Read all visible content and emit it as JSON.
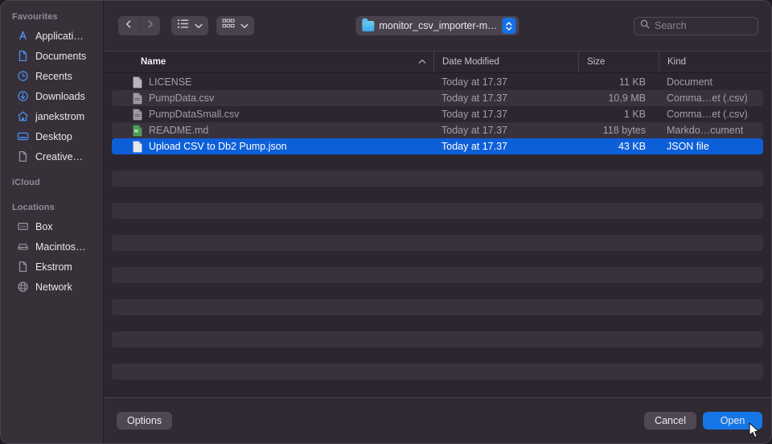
{
  "window": {
    "title": "Open File Dialog",
    "accent_color": "#1577e6",
    "selection_color": "#0d5fd8",
    "background": "#2f2a34",
    "sidebar_background": "#373039",
    "list_background": "#2b2630",
    "stripe_color": "#38323d"
  },
  "sidebar": {
    "sections": [
      {
        "header": "Favourites",
        "items": [
          {
            "label": "Applicati…",
            "icon": "applications-icon",
            "color": "#4a90f0"
          },
          {
            "label": "Documents",
            "icon": "documents-folder-icon",
            "color": "#4a90f0"
          },
          {
            "label": "Recents",
            "icon": "clock-icon",
            "color": "#4a90f0"
          },
          {
            "label": "Downloads",
            "icon": "download-circle-icon",
            "color": "#4a90f0"
          },
          {
            "label": "janekstrom",
            "icon": "home-icon",
            "color": "#4a90f0"
          },
          {
            "label": "Desktop",
            "icon": "desktop-icon",
            "color": "#4a90f0"
          },
          {
            "label": "Creative…",
            "icon": "document-icon",
            "color": "#9a939f"
          }
        ]
      },
      {
        "header": "iCloud",
        "items": []
      },
      {
        "header": "Locations",
        "items": [
          {
            "label": "Box",
            "icon": "box-drive-icon",
            "color": "#9a939f"
          },
          {
            "label": "Macintos…",
            "icon": "hard-drive-icon",
            "color": "#9a939f"
          },
          {
            "label": "Ekstrom",
            "icon": "document-icon",
            "color": "#9a939f"
          },
          {
            "label": "Network",
            "icon": "globe-icon",
            "color": "#9a939f"
          }
        ]
      }
    ]
  },
  "toolbar": {
    "back_icon": "chevron-left-icon",
    "forward_icon": "chevron-right-icon",
    "list_view_icon": "list-view-icon",
    "grid_view_icon": "grid-view-icon",
    "view_chevron_icon": "chevron-down-icon",
    "path": {
      "label": "monitor_csv_importer-m…",
      "folder_icon": "folder-icon",
      "stepper_icon": "up-down-stepper-icon"
    },
    "search": {
      "placeholder": "Search",
      "icon": "search-icon"
    }
  },
  "columns": {
    "name": "Name",
    "date_modified": "Date Modified",
    "size": "Size",
    "kind": "Kind",
    "sort_column": "Name",
    "sort_direction": "ascending",
    "sort_icon": "chevron-up-icon"
  },
  "files": [
    {
      "name": "LICENSE",
      "date_modified": "Today at 17.37",
      "size": "11 KB",
      "kind": "Document",
      "icon": "document-file-icon",
      "icon_tint": "#b9b4bd",
      "selected": false
    },
    {
      "name": "PumpData.csv",
      "date_modified": "Today at 17.37",
      "size": "10,9 MB",
      "kind": "Comma…et (.csv)",
      "icon": "csv-file-icon",
      "icon_tint": "#9d9aa2",
      "selected": false
    },
    {
      "name": "PumpDataSmall.csv",
      "date_modified": "Today at 17.37",
      "size": "1 KB",
      "kind": "Comma…et (.csv)",
      "icon": "csv-file-icon",
      "icon_tint": "#9d9aa2",
      "selected": false
    },
    {
      "name": "README.md",
      "date_modified": "Today at 17.37",
      "size": "118 bytes",
      "kind": "Markdo…cument",
      "icon": "markdown-file-icon",
      "icon_tint": "#4f9e5c",
      "selected": false
    },
    {
      "name": "Upload CSV to Db2 Pump.json",
      "date_modified": "Today at 17.37",
      "size": "43 KB",
      "kind": "JSON file",
      "icon": "json-file-icon",
      "icon_tint": "#e8e6ea",
      "selected": true
    }
  ],
  "empty_row_count": 15,
  "footer": {
    "options_label": "Options",
    "cancel_label": "Cancel",
    "open_label": "Open",
    "default_button": "Open",
    "cursor_icon": "mouse-pointer-icon"
  }
}
